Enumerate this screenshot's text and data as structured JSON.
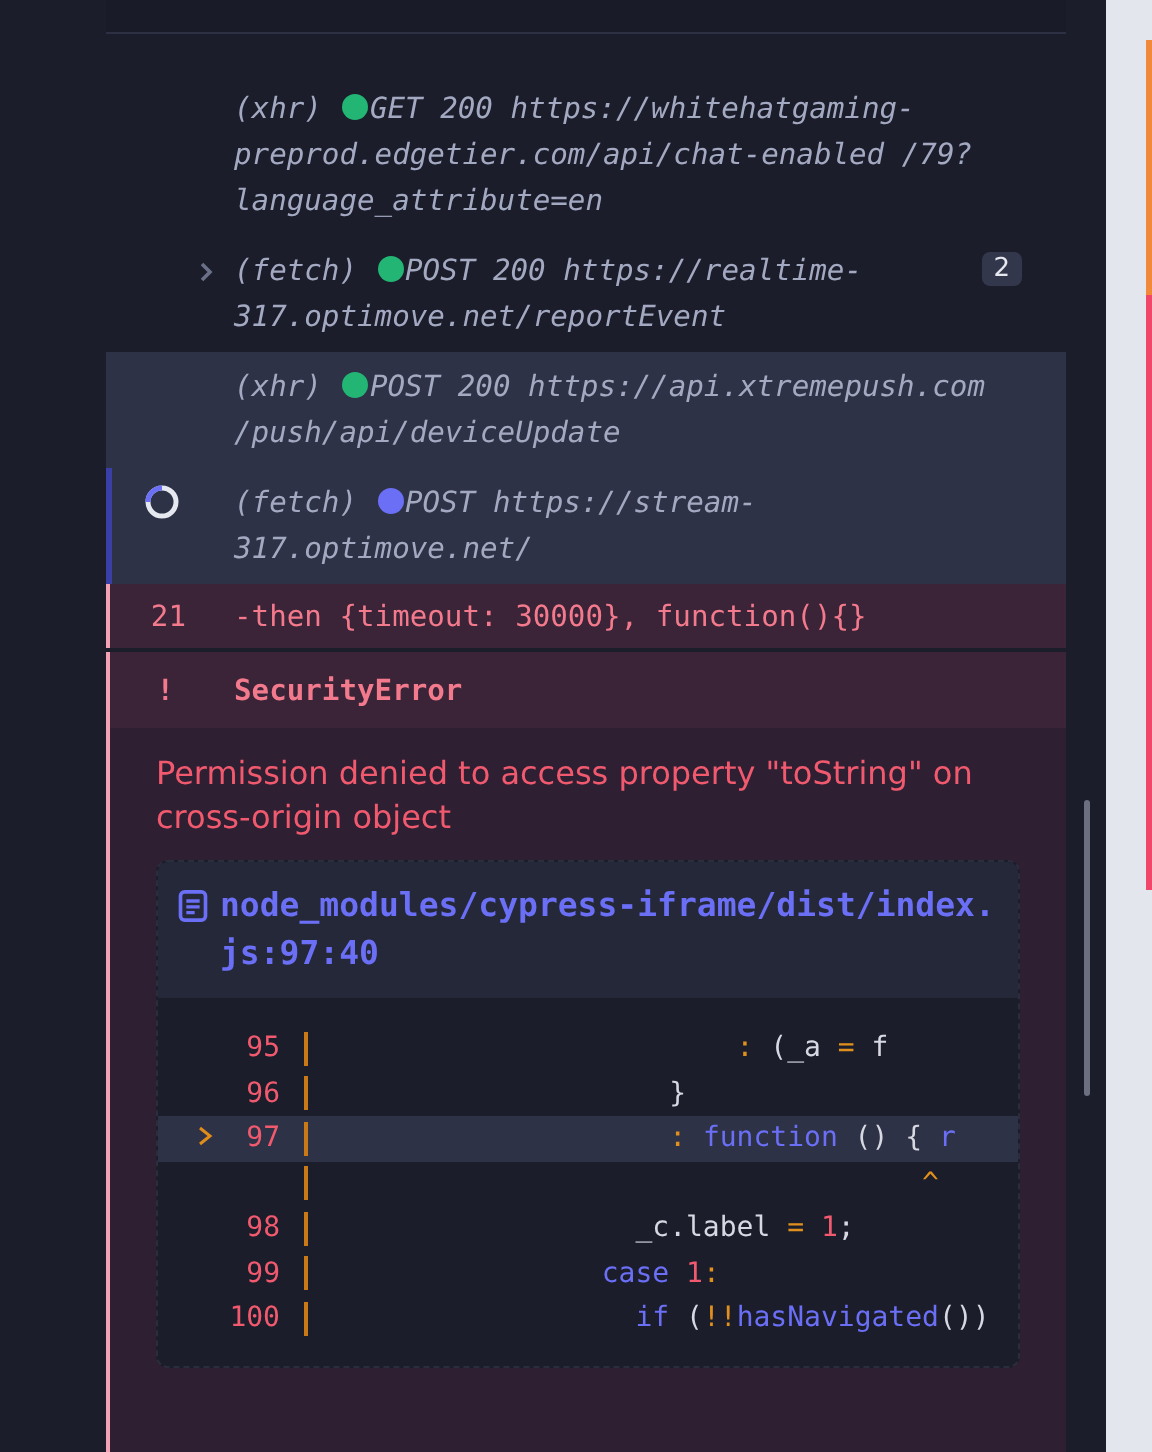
{
  "command_log": [
    {
      "type": "(xhr)",
      "method": "GET",
      "code": "200",
      "url": "https://whitehatgaming-preprod.edgetier.com/api/chat-enabled /79?language_attribute=en",
      "color": "#22b573",
      "selected": false,
      "pending": false,
      "expandable": false
    },
    {
      "type": "(fetch)",
      "method": "POST",
      "code": "200",
      "url": "https://realtime-317.optimove.net/reportEvent",
      "color": "#22b573",
      "selected": false,
      "pending": false,
      "expandable": true,
      "count": "2"
    },
    {
      "type": "(xhr)",
      "method": "POST",
      "code": "200",
      "url": "https://api.xtremepush.com /push/api/deviceUpdate",
      "color": "#22b573",
      "selected": true,
      "pending": false,
      "expandable": false
    },
    {
      "type": "(fetch)",
      "method": "POST",
      "url": "https://stream-317.optimove.net/",
      "color": "#6a6ff5",
      "selected": true,
      "pending": true,
      "expandable": false
    }
  ],
  "failed_command": {
    "number": "21",
    "text": "-then  {timeout: 30000}, function(){}"
  },
  "error": {
    "mark": "!",
    "name": "SecurityError",
    "message": "Permission denied to access property \"toString\" on cross-origin object",
    "file": "node_modules/cypress-iframe/dist/index.js:97:40",
    "code_lines": [
      {
        "number": "95",
        "current": false,
        "tokens": [
          {
            "kind": "op",
            "text": "                        : "
          },
          {
            "kind": "plain",
            "text": "(_a "
          },
          {
            "kind": "op",
            "text": "= "
          },
          {
            "kind": "plain",
            "text": "f"
          }
        ]
      },
      {
        "number": "96",
        "current": false,
        "tokens": [
          {
            "kind": "plain",
            "text": "                    }"
          }
        ]
      },
      {
        "number": "97",
        "current": true,
        "tokens": [
          {
            "kind": "op",
            "text": "                    : "
          },
          {
            "kind": "keyword",
            "text": "function "
          },
          {
            "kind": "plain",
            "text": "() { "
          },
          {
            "kind": "keyword",
            "text": "r"
          }
        ]
      },
      {
        "current": false,
        "tokens": [
          {
            "kind": "op",
            "text": "                                   ^"
          }
        ]
      },
      {
        "number": "98",
        "current": false,
        "tokens": [
          {
            "kind": "plain",
            "text": "                  _c.label "
          },
          {
            "kind": "op",
            "text": "= "
          },
          {
            "kind": "number",
            "text": "1"
          },
          {
            "kind": "plain",
            "text": ";"
          }
        ]
      },
      {
        "number": "99",
        "current": false,
        "tokens": [
          {
            "kind": "keyword",
            "text": "                case "
          },
          {
            "kind": "number",
            "text": "1"
          },
          {
            "kind": "op",
            "text": ":"
          }
        ]
      },
      {
        "number": "100",
        "current": false,
        "tokens": [
          {
            "kind": "keyword",
            "text": "                  if "
          },
          {
            "kind": "plain",
            "text": "("
          },
          {
            "kind": "op",
            "text": "!!"
          },
          {
            "kind": "keyword",
            "text": "hasNavigated"
          },
          {
            "kind": "plain",
            "text": "())"
          }
        ]
      }
    ]
  }
}
